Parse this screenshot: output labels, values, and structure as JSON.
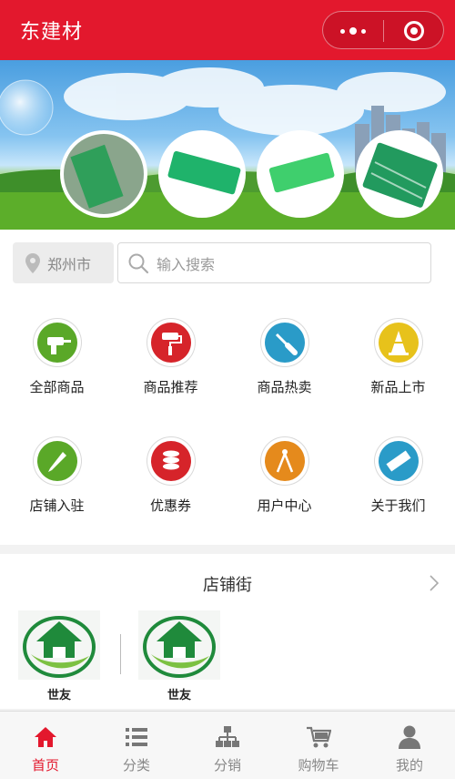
{
  "header": {
    "title": "东建材"
  },
  "search_row": {
    "city": "郑州市",
    "search_placeholder": "输入搜索"
  },
  "grid": {
    "items": [
      {
        "label": "全部商品",
        "icon": "drill-icon",
        "color": "#5aa828"
      },
      {
        "label": "商品推荐",
        "icon": "paint-roller-icon",
        "color": "#d6242a"
      },
      {
        "label": "商品热卖",
        "icon": "screwdriver-icon",
        "color": "#2a9bc8"
      },
      {
        "label": "新品上市",
        "icon": "traffic-cone-icon",
        "color": "#e7c21b"
      },
      {
        "label": "店铺入驻",
        "icon": "pencil-icon",
        "color": "#5aa828"
      },
      {
        "label": "优惠券",
        "icon": "coins-icon",
        "color": "#d6242a"
      },
      {
        "label": "用户中心",
        "icon": "compass-icon",
        "color": "#e58a1c"
      },
      {
        "label": "关于我们",
        "icon": "ruler-icon",
        "color": "#2a9bc8"
      }
    ]
  },
  "shop_street": {
    "title": "店铺街",
    "stores": [
      {
        "name": "世友"
      },
      {
        "name": "世友"
      }
    ]
  },
  "tabbar": {
    "tabs": [
      {
        "label": "首页",
        "icon": "home-icon",
        "active": true
      },
      {
        "label": "分类",
        "icon": "list-icon",
        "active": false
      },
      {
        "label": "分销",
        "icon": "org-chart-icon",
        "active": false
      },
      {
        "label": "购物车",
        "icon": "cart-icon",
        "active": false
      },
      {
        "label": "我的",
        "icon": "user-icon",
        "active": false
      }
    ]
  },
  "colors": {
    "brand": "#e3182d",
    "inactive_tab": "#888888"
  }
}
